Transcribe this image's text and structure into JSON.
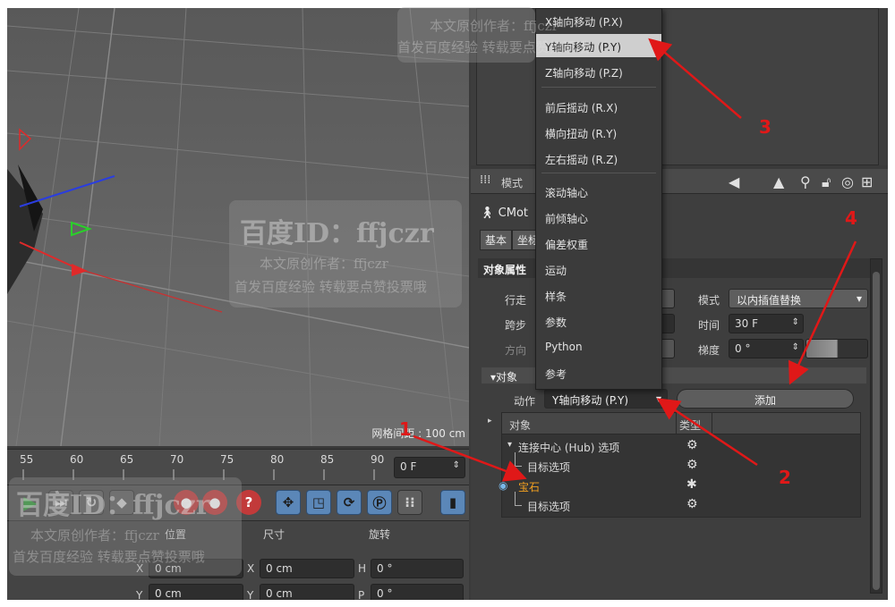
{
  "viewport": {
    "grid_spacing_label": "网格间距 : 100 cm"
  },
  "timeline": {
    "ticks": [
      "55",
      "60",
      "65",
      "70",
      "75",
      "80",
      "85",
      "90"
    ],
    "frame_value": "0 F"
  },
  "coords": {
    "headers": [
      "位置",
      "尺寸",
      "旋转"
    ],
    "rows": [
      {
        "axis1": "X",
        "pos": "0 cm",
        "axis2": "X",
        "size": "0 cm",
        "axis3": "H",
        "rot": "0 °"
      },
      {
        "axis1": "Y",
        "pos": "0 cm",
        "axis2": "Y",
        "size": "0 cm",
        "axis3": "P",
        "rot": "0 °"
      }
    ]
  },
  "attr": {
    "mode_label": "模式",
    "object_name": "CMot",
    "tabs": [
      "基本",
      "坐标"
    ],
    "section_title": "对象属性",
    "walk_label": "行走",
    "stride_label": "跨步",
    "direction_label": "方向",
    "mode2_label": "模式",
    "mode2_value": "以内插值替换",
    "time_label": "时间",
    "time_value": "30 F",
    "gradient_label": "梯度",
    "gradient_value": "0 °",
    "object_section": "▾对象",
    "action_label": "动作",
    "action_value": "Y轴向移动 (P.Y)",
    "add_button": "添加",
    "tree": {
      "col_object": "对象",
      "col_type": "类型",
      "rows": [
        {
          "label": "连接中心 (Hub) 选项",
          "selected": false
        },
        {
          "label": "目标选项",
          "selected": false
        },
        {
          "label": "宝石",
          "selected": true
        },
        {
          "label": "目标选项",
          "selected": false
        }
      ]
    }
  },
  "menu": {
    "items": [
      {
        "label": "X轴向移动 (P.X)",
        "highlight": false
      },
      {
        "label": "Y轴向移动 (P.Y)",
        "highlight": true
      },
      {
        "label": "Z轴向移动 (P.Z)",
        "highlight": false
      },
      {
        "label": "前后摇动 (R.X)",
        "highlight": false
      },
      {
        "label": "横向扭动 (R.Y)",
        "highlight": false
      },
      {
        "label": "左右摇动 (R.Z)",
        "highlight": false
      },
      {
        "label": "滚动轴心",
        "highlight": false
      },
      {
        "label": "前倾轴心",
        "highlight": false
      },
      {
        "label": "偏差权重",
        "highlight": false
      },
      {
        "label": "运动",
        "highlight": false
      },
      {
        "label": "样条",
        "highlight": false
      },
      {
        "label": "参数",
        "highlight": false
      },
      {
        "label": "Python",
        "highlight": false
      },
      {
        "label": "参考",
        "highlight": false
      }
    ]
  },
  "watermark": {
    "id_line": "百度ID：ffjczr",
    "author_line": "本文原创作者：ffjczr",
    "notice_line": "首发百度经验 转载要点赞投票哦"
  },
  "annotations": [
    "1",
    "2",
    "3",
    "4"
  ],
  "colors": {
    "annotation_red": "#e01818",
    "selected_orange": "#f2a020",
    "menu_highlight": "#cfcfcf"
  }
}
